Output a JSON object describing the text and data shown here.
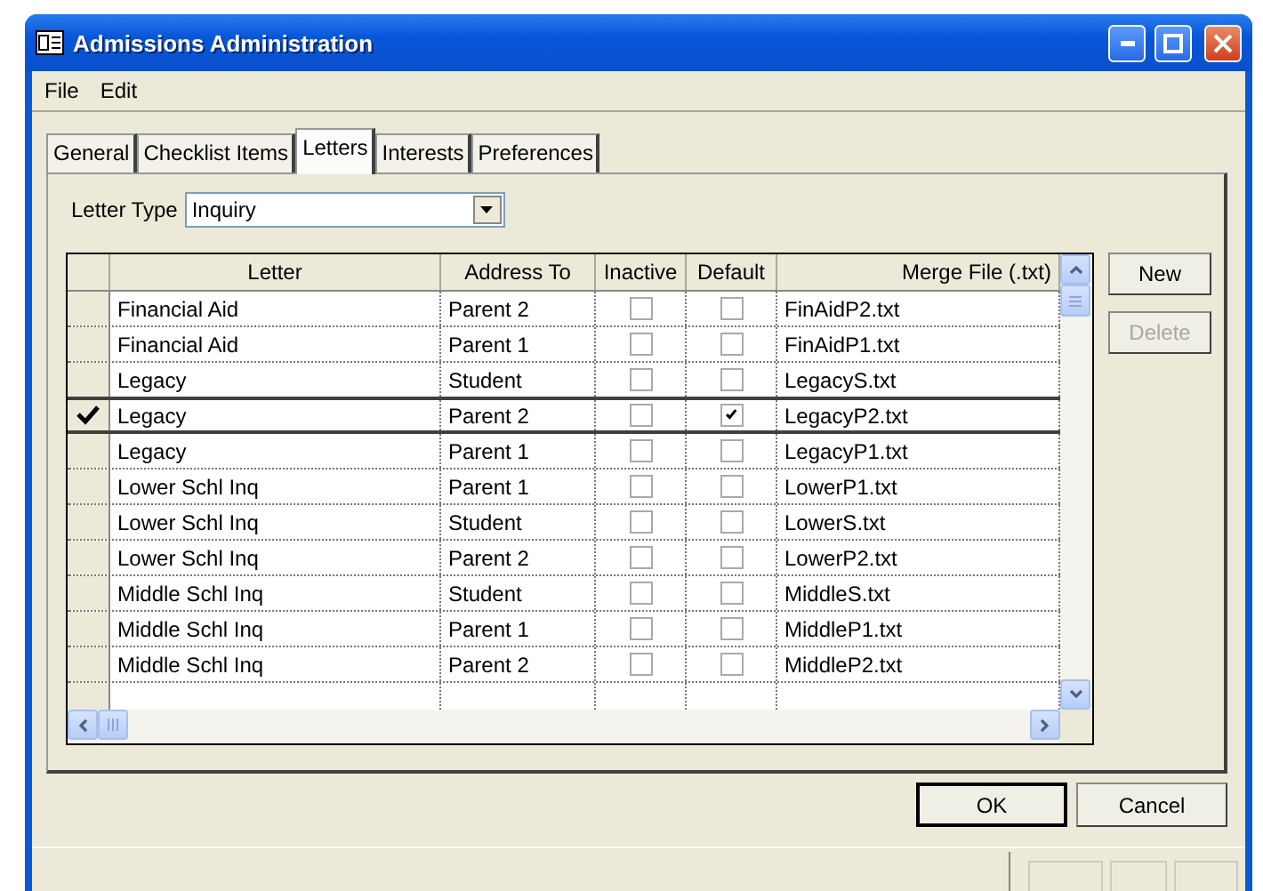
{
  "window": {
    "title": "Admissions Administration"
  },
  "menu": [
    "File",
    "Edit"
  ],
  "tabs": [
    {
      "label": "General",
      "selected": false
    },
    {
      "label": "Checklist Items",
      "selected": false
    },
    {
      "label": "Letters",
      "selected": true
    },
    {
      "label": "Interests",
      "selected": false
    },
    {
      "label": "Preferences",
      "selected": false
    }
  ],
  "letter_type": {
    "label": "Letter Type",
    "value": "Inquiry"
  },
  "table": {
    "columns": [
      "Letter",
      "Address To",
      "Inactive",
      "Default",
      "Merge File (.txt)"
    ],
    "rows": [
      {
        "letter": "Financial Aid",
        "address_to": "Parent 2",
        "inactive": false,
        "default": false,
        "merge_file": "FinAidP2.txt",
        "selected": false
      },
      {
        "letter": "Financial Aid",
        "address_to": "Parent 1",
        "inactive": false,
        "default": false,
        "merge_file": "FinAidP1.txt",
        "selected": false
      },
      {
        "letter": "Legacy",
        "address_to": "Student",
        "inactive": false,
        "default": false,
        "merge_file": "LegacyS.txt",
        "selected": false
      },
      {
        "letter": "Legacy",
        "address_to": "Parent 2",
        "inactive": false,
        "default": true,
        "merge_file": "LegacyP2.txt",
        "selected": true
      },
      {
        "letter": "Legacy",
        "address_to": "Parent 1",
        "inactive": false,
        "default": false,
        "merge_file": "LegacyP1.txt",
        "selected": false
      },
      {
        "letter": "Lower Schl Inq",
        "address_to": "Parent 1",
        "inactive": false,
        "default": false,
        "merge_file": "LowerP1.txt",
        "selected": false
      },
      {
        "letter": "Lower Schl Inq",
        "address_to": "Student",
        "inactive": false,
        "default": false,
        "merge_file": "LowerS.txt",
        "selected": false
      },
      {
        "letter": "Lower Schl Inq",
        "address_to": "Parent 2",
        "inactive": false,
        "default": false,
        "merge_file": "LowerP2.txt",
        "selected": false
      },
      {
        "letter": "Middle Schl Inq",
        "address_to": "Student",
        "inactive": false,
        "default": false,
        "merge_file": "MiddleS.txt",
        "selected": false
      },
      {
        "letter": "Middle Schl Inq",
        "address_to": "Parent 1",
        "inactive": false,
        "default": false,
        "merge_file": "MiddleP1.txt",
        "selected": false
      },
      {
        "letter": "Middle Schl Inq",
        "address_to": "Parent 2",
        "inactive": false,
        "default": false,
        "merge_file": "MiddleP2.txt",
        "selected": false
      }
    ]
  },
  "side_buttons": [
    {
      "label": "New",
      "disabled": false
    },
    {
      "label": "Delete",
      "disabled": true
    }
  ],
  "buttons": [
    "OK",
    "Cancel"
  ]
}
